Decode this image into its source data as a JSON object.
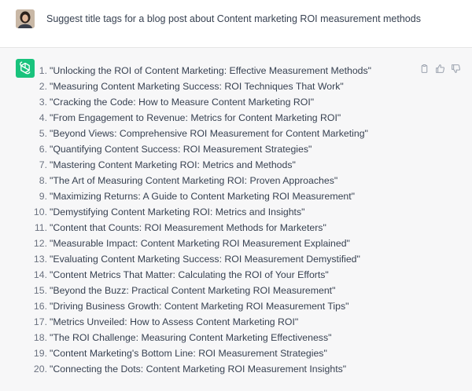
{
  "user": {
    "message": "Suggest title tags for a blog post about Content marketing ROI measurement methods"
  },
  "assistant": {
    "icon": "openai-logo-icon",
    "accent_color": "#19c37d",
    "titles": [
      {
        "num": "1.",
        "text": "\"Unlocking the ROI of Content Marketing: Effective Measurement Methods\""
      },
      {
        "num": "2.",
        "text": "\"Measuring Content Marketing Success: ROI Techniques That Work\""
      },
      {
        "num": "3.",
        "text": "\"Cracking the Code: How to Measure Content Marketing ROI\""
      },
      {
        "num": "4.",
        "text": "\"From Engagement to Revenue: Metrics for Content Marketing ROI\""
      },
      {
        "num": "5.",
        "text": "\"Beyond Views: Comprehensive ROI Measurement for Content Marketing\""
      },
      {
        "num": "6.",
        "text": "\"Quantifying Content Success: ROI Measurement Strategies\""
      },
      {
        "num": "7.",
        "text": "\"Mastering Content Marketing ROI: Metrics and Methods\""
      },
      {
        "num": "8.",
        "text": "\"The Art of Measuring Content Marketing ROI: Proven Approaches\""
      },
      {
        "num": "9.",
        "text": "\"Maximizing Returns: A Guide to Content Marketing ROI Measurement\""
      },
      {
        "num": "10.",
        "text": "\"Demystifying Content Marketing ROI: Metrics and Insights\""
      },
      {
        "num": "11.",
        "text": "\"Content that Counts: ROI Measurement Methods for Marketers\""
      },
      {
        "num": "12.",
        "text": "\"Measurable Impact: Content Marketing ROI Measurement Explained\""
      },
      {
        "num": "13.",
        "text": "\"Evaluating Content Marketing Success: ROI Measurement Demystified\""
      },
      {
        "num": "14.",
        "text": "\"Content Metrics That Matter: Calculating the ROI of Your Efforts\""
      },
      {
        "num": "15.",
        "text": "\"Beyond the Buzz: Practical Content Marketing ROI Measurement\""
      },
      {
        "num": "16.",
        "text": "\"Driving Business Growth: Content Marketing ROI Measurement Tips\""
      },
      {
        "num": "17.",
        "text": "\"Metrics Unveiled: How to Assess Content Marketing ROI\""
      },
      {
        "num": "18.",
        "text": "\"The ROI Challenge: Measuring Content Marketing Effectiveness\""
      },
      {
        "num": "19.",
        "text": "\"Content Marketing's Bottom Line: ROI Measurement Strategies\""
      },
      {
        "num": "20.",
        "text": "\"Connecting the Dots: Content Marketing ROI Measurement Insights\""
      }
    ]
  },
  "actions": [
    {
      "name": "copy-icon"
    },
    {
      "name": "thumbs-up-icon"
    },
    {
      "name": "thumbs-down-icon"
    }
  ]
}
